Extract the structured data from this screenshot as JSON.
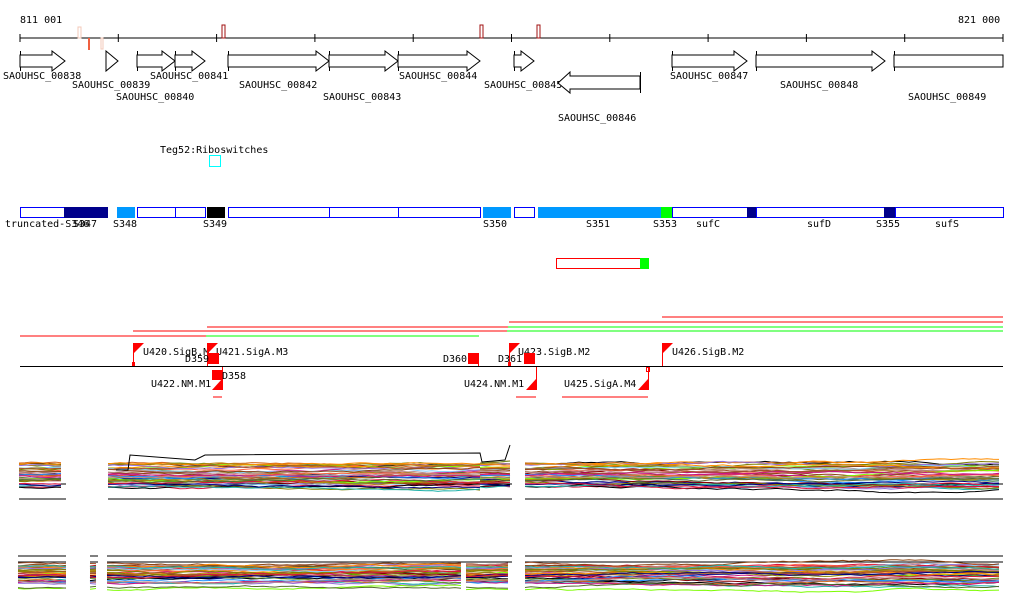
{
  "ruler": {
    "start_label": "811 001",
    "end_label": "821 000"
  },
  "genes": [
    {
      "id": "SAOUHSC_00838",
      "strand": "+"
    },
    {
      "id": "SAOUHSC_00839",
      "strand": "+"
    },
    {
      "id": "SAOUHSC_00840",
      "strand": "+"
    },
    {
      "id": "SAOUHSC_00841",
      "strand": "+"
    },
    {
      "id": "SAOUHSC_00842",
      "strand": "+"
    },
    {
      "id": "SAOUHSC_00843",
      "strand": "+"
    },
    {
      "id": "SAOUHSC_00844",
      "strand": "+"
    },
    {
      "id": "SAOUHSC_00845",
      "strand": "+"
    },
    {
      "id": "SAOUHSC_00846",
      "strand": "-"
    },
    {
      "id": "SAOUHSC_00847",
      "strand": "+"
    },
    {
      "id": "SAOUHSC_00848",
      "strand": "+"
    },
    {
      "id": "SAOUHSC_00849",
      "strand": "+"
    }
  ],
  "riboswitch": {
    "label": "Teg52:Riboswitches",
    "color": "#00ffff"
  },
  "segments": {
    "labels": [
      "truncated-S346",
      "S347",
      "S348",
      "S349",
      "S350",
      "S351",
      "S353",
      "sufC",
      "sufD",
      "S355",
      "sufS"
    ],
    "colors": {
      "outline": "#0000ff",
      "dark": "#00008b",
      "light": "#0099ff",
      "black": "#000000",
      "green": "#00ff00"
    }
  },
  "features": {
    "flags": [
      "U420.SigB.M",
      "U421.SigA.M3",
      "U423.SigB.M2",
      "U426.SigB.M2",
      "U422.NM.M1",
      "U424.NM.M1",
      "U425.SigA.M4"
    ],
    "boxes": [
      "D359",
      "D358",
      "D360",
      "D361"
    ],
    "color": "#ff0000"
  }
}
